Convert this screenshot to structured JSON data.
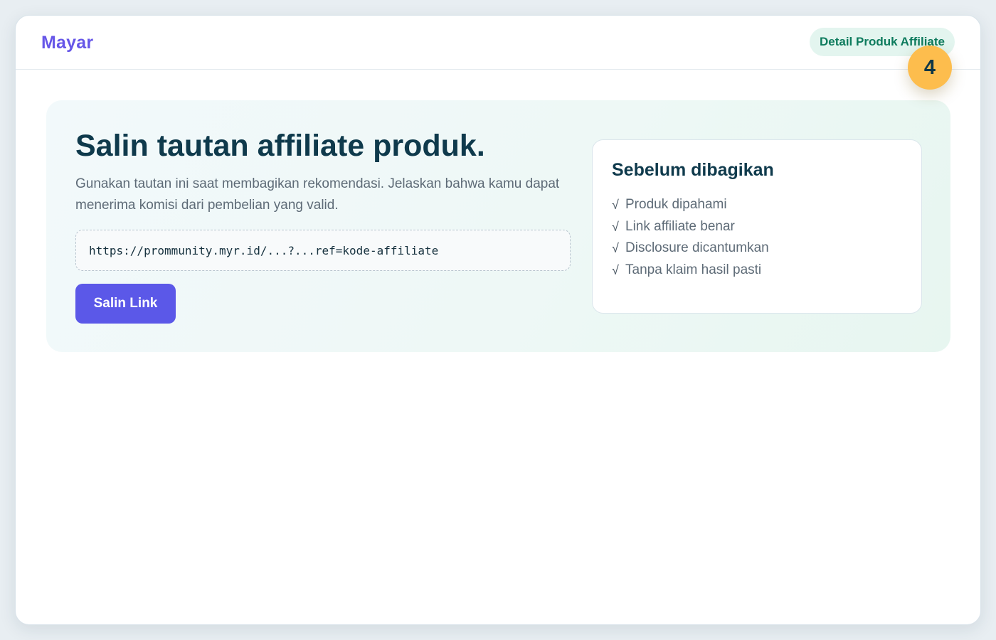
{
  "header": {
    "brand": "Mayar",
    "page_pill": "Detail Produk Affiliate",
    "step_number": "4"
  },
  "hero": {
    "title": "Salin tautan affiliate produk.",
    "description": "Gunakan tautan ini saat membagikan rekomendasi. Jelaskan bahwa kamu dapat menerima komisi dari pembelian yang valid.",
    "link_value": "https://prommunity.myr.id/...?...ref=kode-affiliate",
    "copy_button_label": "Salin Link"
  },
  "checklist": {
    "title": "Sebelum dibagikan",
    "check_icon": "check-icon",
    "check_glyph": "√",
    "items": [
      "Produk dipahami",
      "Link affiliate benar",
      "Disclosure dicantumkan",
      "Tanpa klaim hasil pasti"
    ]
  },
  "colors": {
    "brand": "#6656e8",
    "primary_button": "#5b58e8",
    "pill_bg": "#e3f5ef",
    "pill_text": "#0d7b5d",
    "step_badge": "#fdbd4d",
    "heading": "#0f3a4c"
  }
}
